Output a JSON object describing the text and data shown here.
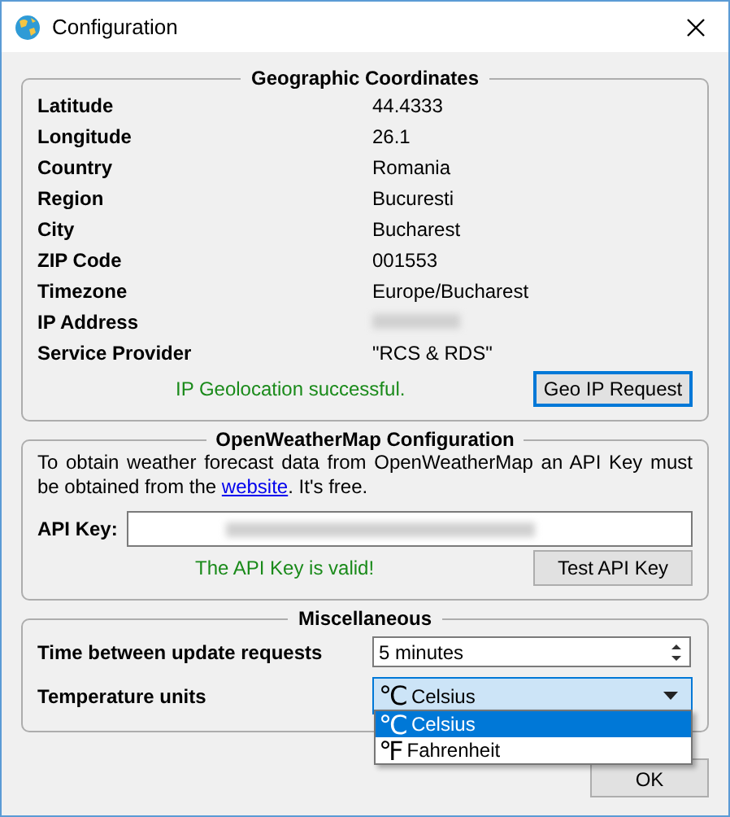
{
  "window": {
    "title": "Configuration"
  },
  "geo": {
    "title": "Geographic Coordinates",
    "fields": [
      {
        "label": "Latitude",
        "value": "44.4333"
      },
      {
        "label": "Longitude",
        "value": "26.1"
      },
      {
        "label": "Country",
        "value": "Romania"
      },
      {
        "label": "Region",
        "value": "Bucuresti"
      },
      {
        "label": "City",
        "value": "Bucharest"
      },
      {
        "label": "ZIP Code",
        "value": "001553"
      },
      {
        "label": "Timezone",
        "value": "Europe/Bucharest"
      },
      {
        "label": "IP Address",
        "kind": "blurred"
      },
      {
        "label": "Service Provider",
        "value": "\"RCS & RDS\""
      }
    ],
    "status": "IP Geolocation successful.",
    "button": "Geo IP Request"
  },
  "owm": {
    "title": "OpenWeatherMap Configuration",
    "text_before": "To obtain weather forecast data from OpenWeatherMap an API Key must be obtained from the ",
    "link": "website",
    "text_after": ". It's free.",
    "api_key_label": "API Key:",
    "status": "The API Key is valid!",
    "button": "Test API Key"
  },
  "misc": {
    "title": "Miscellaneous",
    "interval_label": "Time between update requests",
    "interval_value": "5 minutes",
    "units_label": "Temperature units",
    "units_symbol": "℃",
    "units_value": "Celsius",
    "options": [
      {
        "symbol": "℃",
        "label": "Celsius",
        "selected": true
      },
      {
        "symbol": "℉",
        "label": "Fahrenheit",
        "selected": false
      }
    ]
  },
  "ok_button": "OK"
}
